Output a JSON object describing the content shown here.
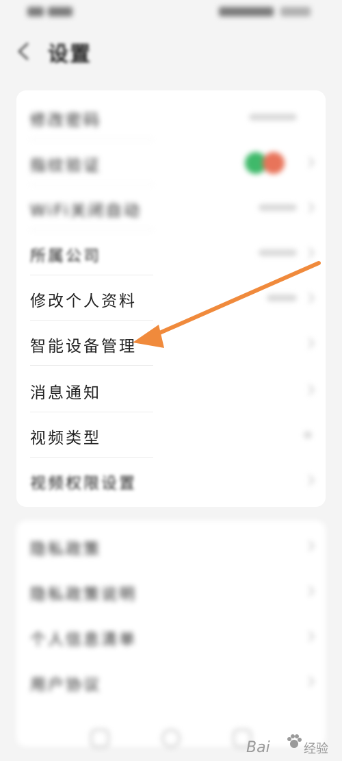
{
  "header": {
    "title": "设置"
  },
  "card1": {
    "rows": [
      {
        "label": "修改密码"
      },
      {
        "label": "指纹验证"
      },
      {
        "label": "WiFi关闭自动"
      },
      {
        "label": "所属公司"
      },
      {
        "label": "修改个人资料"
      },
      {
        "label": "智能设备管理"
      },
      {
        "label": "消息通知"
      },
      {
        "label": "视频类型"
      },
      {
        "label": "视频权限设置"
      }
    ]
  },
  "card2": {
    "rows": [
      {
        "label": "隐私政策"
      },
      {
        "label": "隐私政策说明"
      },
      {
        "label": "个人信息清单"
      },
      {
        "label": "用户协议"
      }
    ]
  },
  "colors": {
    "accent_arrow": "#f08a3c",
    "toggle_green": "#3fb96a",
    "toggle_red": "#e8745a"
  },
  "icons": [
    "back-arrow-icon",
    "chevron-right-icon",
    "toggle-switch",
    "annotation-arrow",
    "home-icon",
    "apps-icon",
    "profile-icon",
    "baidu-paw-icon"
  ],
  "watermark": {
    "brand": "Bai",
    "suffix": "经验"
  }
}
